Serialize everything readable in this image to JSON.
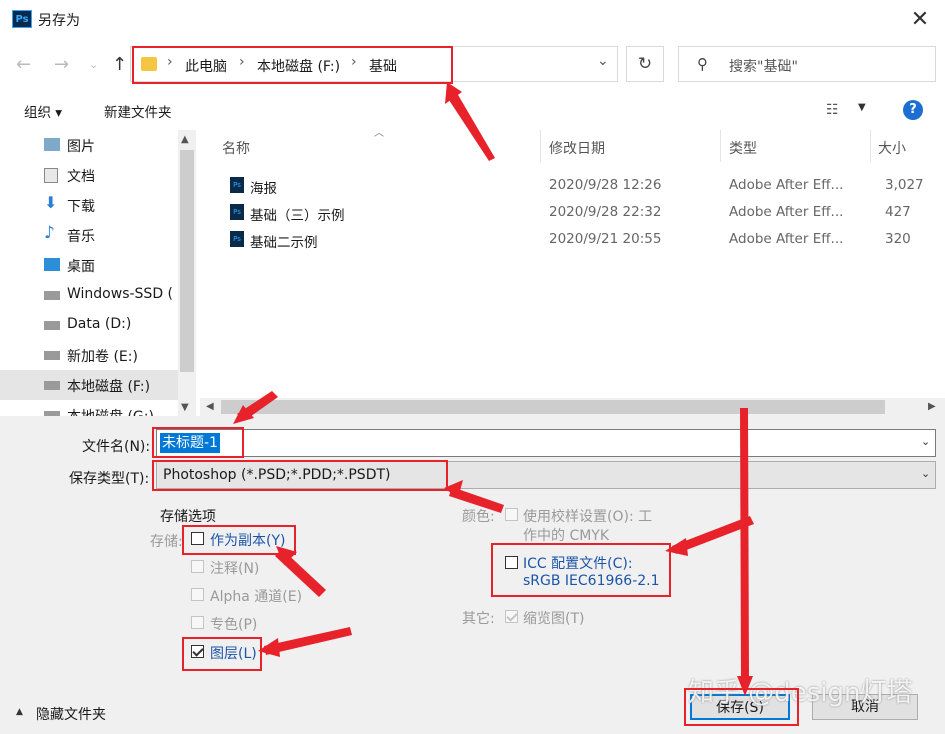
{
  "window": {
    "title": "另存为",
    "app_icon": "Ps"
  },
  "address": {
    "crumbs": [
      "此电脑",
      "本地磁盘 (F:)",
      "基础"
    ]
  },
  "search": {
    "placeholder": "搜索\"基础\""
  },
  "toolbar": {
    "organize": "组织 ▾",
    "new_folder": "新建文件夹",
    "help": "?"
  },
  "sidebar": {
    "items": [
      {
        "label": "图片",
        "icon": "pictures-icon"
      },
      {
        "label": "文档",
        "icon": "documents-icon"
      },
      {
        "label": "下载",
        "icon": "download-icon"
      },
      {
        "label": "音乐",
        "icon": "music-icon"
      },
      {
        "label": "桌面",
        "icon": "desktop-icon"
      },
      {
        "label": "Windows-SSD (",
        "icon": "drive-icon"
      },
      {
        "label": "Data (D:)",
        "icon": "drive-icon"
      },
      {
        "label": "新加卷 (E:)",
        "icon": "drive-icon"
      },
      {
        "label": "本地磁盘 (F:)",
        "icon": "drive-icon",
        "selected": true
      },
      {
        "label": "本地磁盘 (G:)",
        "icon": "drive-icon"
      }
    ]
  },
  "file_list": {
    "columns": [
      "名称",
      "修改日期",
      "类型",
      "大小"
    ],
    "rows": [
      {
        "name": "海报",
        "date": "2020/9/28 12:26",
        "type": "Adobe After Eff...",
        "size": "3,027"
      },
      {
        "name": "基础（三）示例",
        "date": "2020/9/28 22:32",
        "type": "Adobe After Eff...",
        "size": "427"
      },
      {
        "name": "基础二示例",
        "date": "2020/9/21 20:55",
        "type": "Adobe After Eff...",
        "size": "320"
      }
    ]
  },
  "form": {
    "filename_label": "文件名(N):",
    "filename_value": "未标题-1",
    "filetype_label": "保存类型(T):",
    "filetype_value": "Photoshop (*.PSD;*.PDD;*.PSDT)"
  },
  "options": {
    "heading": "存储选项",
    "storage_label": "存储:",
    "as_copy": "作为副本(Y)",
    "notes": "注释(N)",
    "alpha": "Alpha 通道(E)",
    "spot": "专色(P)",
    "layers": "图层(L)",
    "color_label": "颜色:",
    "proof_line1": "使用校样设置(O):  工",
    "proof_line2": "作中的 CMYK",
    "icc_line1": "ICC 配置文件(C):",
    "icc_line2": "sRGB IEC61966-2.1",
    "other_label": "其它:",
    "thumbnail": "缩览图(T)"
  },
  "footer": {
    "hide_folders": "隐藏文件夹",
    "save": "保存(S)",
    "cancel": "取消"
  },
  "watermark": "知乎 @design灯塔",
  "colors": {
    "annotation_red": "#e8222a",
    "selection_blue": "#0078d7",
    "link_blue": "#1c55a8"
  }
}
